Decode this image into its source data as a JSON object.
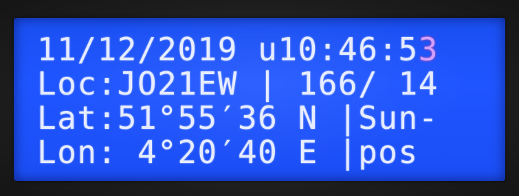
{
  "display": {
    "line1_main": "11/12/2019 u10:46:5",
    "line1_last": "3",
    "line2": "Loc:JO21EW | 166/ 14",
    "line3": "Lat:51°55′36 N |Sun-",
    "line4": "Lon: 4°20′40 E |pos"
  },
  "colors": {
    "backlight": "#1f55ff",
    "text": "#e6ecff",
    "bezel": "#1c1c1c"
  }
}
